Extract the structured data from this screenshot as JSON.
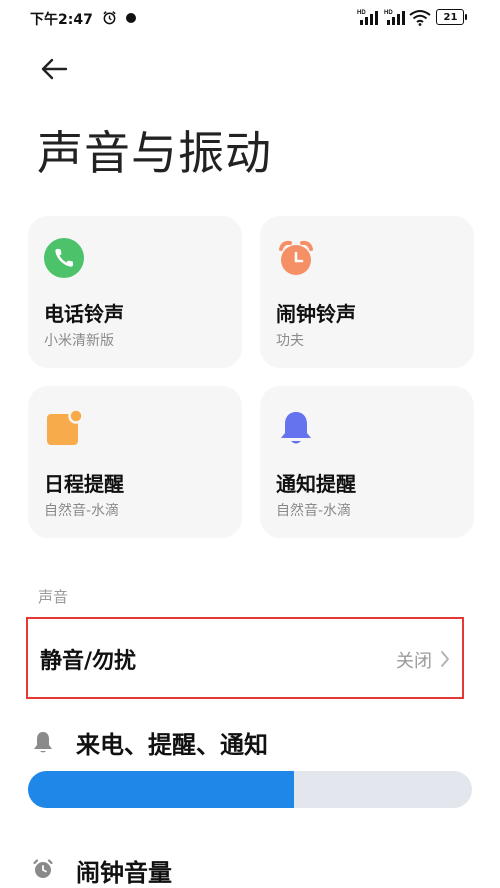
{
  "status_bar": {
    "time": "下午2:47",
    "battery": "21"
  },
  "header": {
    "title": "声音与振动"
  },
  "cards": [
    {
      "title": "电话铃声",
      "subtitle": "小米清新版",
      "icon": "phone-icon",
      "color": "#4cc26a"
    },
    {
      "title": "闹钟铃声",
      "subtitle": "功夫",
      "icon": "alarm-clock-icon",
      "color": "#f58f65"
    },
    {
      "title": "日程提醒",
      "subtitle": "自然音-水滴",
      "icon": "calendar-note-icon",
      "color": "#f7ab4a"
    },
    {
      "title": "通知提醒",
      "subtitle": "自然音-水滴",
      "icon": "bell-icon",
      "color": "#6673ee"
    }
  ],
  "sound": {
    "section_label": "声音",
    "dnd": {
      "label": "静音/勿扰",
      "value": "关闭"
    },
    "ring_volume": {
      "label": "来电、提醒、通知",
      "level": 0.6,
      "color": "#1f87e8"
    },
    "alarm_volume": {
      "label": "闹钟音量"
    }
  }
}
